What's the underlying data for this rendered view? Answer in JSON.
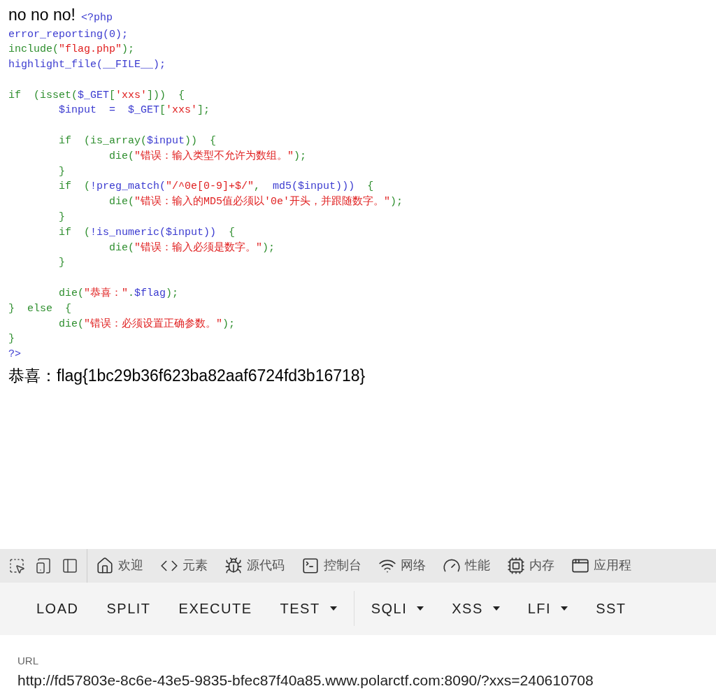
{
  "page": {
    "heading": "no no no!",
    "code": [
      {
        "kind": "code",
        "tokens": [
          {
            "kind": "default",
            "text": "<?php"
          }
        ]
      },
      {
        "kind": "code",
        "tokens": [
          {
            "kind": "default",
            "text": "error_reporting(0);"
          }
        ]
      },
      {
        "kind": "code",
        "tokens": [
          {
            "kind": "keyword",
            "text": "include("
          },
          {
            "kind": "string",
            "text": "\"flag.php\""
          },
          {
            "kind": "keyword",
            "text": ");"
          }
        ]
      },
      {
        "kind": "code",
        "tokens": [
          {
            "kind": "default",
            "text": "highlight_file(__FILE__);"
          }
        ]
      },
      {
        "kind": "blank"
      },
      {
        "kind": "code",
        "tokens": [
          {
            "kind": "keyword",
            "text": "if  (isset("
          },
          {
            "kind": "default",
            "text": "$_GET"
          },
          {
            "kind": "keyword",
            "text": "["
          },
          {
            "kind": "string",
            "text": "'xxs'"
          },
          {
            "kind": "keyword",
            "text": "]))  {"
          }
        ]
      },
      {
        "kind": "code",
        "tokens": [
          {
            "kind": "default",
            "text": "        $input  =  $_GET"
          },
          {
            "kind": "keyword",
            "text": "["
          },
          {
            "kind": "string",
            "text": "'xxs'"
          },
          {
            "kind": "keyword",
            "text": "];"
          }
        ]
      },
      {
        "kind": "blank"
      },
      {
        "kind": "code",
        "tokens": [
          {
            "kind": "keyword",
            "text": "        if  (is_array("
          },
          {
            "kind": "default",
            "text": "$input"
          },
          {
            "kind": "keyword",
            "text": "))  {"
          }
        ]
      },
      {
        "kind": "code",
        "tokens": [
          {
            "kind": "keyword",
            "text": "                die("
          },
          {
            "kind": "string",
            "text": "\"错误：输入类型不允许为数组。\""
          },
          {
            "kind": "keyword",
            "text": ");"
          }
        ]
      },
      {
        "kind": "code",
        "tokens": [
          {
            "kind": "keyword",
            "text": "        }"
          }
        ]
      },
      {
        "kind": "code",
        "tokens": [
          {
            "kind": "keyword",
            "text": "        if  ("
          },
          {
            "kind": "default",
            "text": "!preg_match("
          },
          {
            "kind": "string",
            "text": "\"/^0e[0-9]+$/\""
          },
          {
            "kind": "keyword",
            "text": ",  "
          },
          {
            "kind": "default",
            "text": "md5($input)))"
          },
          {
            "kind": "keyword",
            "text": "  {"
          }
        ]
      },
      {
        "kind": "code",
        "tokens": [
          {
            "kind": "keyword",
            "text": "                die("
          },
          {
            "kind": "string",
            "text": "\"错误：输入的MD5值必须以'0e'开头，并跟随数字。\""
          },
          {
            "kind": "keyword",
            "text": ");"
          }
        ]
      },
      {
        "kind": "code",
        "tokens": [
          {
            "kind": "keyword",
            "text": "        }"
          }
        ]
      },
      {
        "kind": "code",
        "tokens": [
          {
            "kind": "keyword",
            "text": "        if  ("
          },
          {
            "kind": "default",
            "text": "!is_numeric($input))"
          },
          {
            "kind": "keyword",
            "text": "  {"
          }
        ]
      },
      {
        "kind": "code",
        "tokens": [
          {
            "kind": "keyword",
            "text": "                die("
          },
          {
            "kind": "string",
            "text": "\"错误：输入必须是数字。\""
          },
          {
            "kind": "keyword",
            "text": ");"
          }
        ]
      },
      {
        "kind": "code",
        "tokens": [
          {
            "kind": "keyword",
            "text": "        }"
          }
        ]
      },
      {
        "kind": "blank"
      },
      {
        "kind": "code",
        "tokens": [
          {
            "kind": "keyword",
            "text": "        die("
          },
          {
            "kind": "string",
            "text": "\"恭喜：\""
          },
          {
            "kind": "keyword",
            "text": "."
          },
          {
            "kind": "default",
            "text": "$flag"
          },
          {
            "kind": "keyword",
            "text": ");"
          }
        ]
      },
      {
        "kind": "code",
        "tokens": [
          {
            "kind": "keyword",
            "text": "}  else  {"
          }
        ]
      },
      {
        "kind": "code",
        "tokens": [
          {
            "kind": "keyword",
            "text": "        die("
          },
          {
            "kind": "string",
            "text": "\"错误：必须设置正确参数。\""
          },
          {
            "kind": "keyword",
            "text": ");"
          }
        ]
      },
      {
        "kind": "code",
        "tokens": [
          {
            "kind": "keyword",
            "text": "}"
          }
        ]
      },
      {
        "kind": "code",
        "tokens": [
          {
            "kind": "default",
            "text": "?>"
          }
        ]
      }
    ],
    "output": "恭喜：flag{1bc29b36f623ba82aaf6724fd3b16718}"
  },
  "devtools": {
    "tools": [
      {
        "kind": "inspect"
      },
      {
        "kind": "device"
      },
      {
        "kind": "dock"
      }
    ],
    "tabs": [
      {
        "kind": "home",
        "label": "欢迎"
      },
      {
        "kind": "code",
        "label": "元素"
      },
      {
        "kind": "bug",
        "label": "源代码"
      },
      {
        "kind": "console",
        "label": "控制台"
      },
      {
        "kind": "wifi",
        "label": "网络"
      },
      {
        "kind": "gauge",
        "label": "性能"
      },
      {
        "kind": "chip",
        "label": "内存"
      },
      {
        "kind": "app",
        "label": "应用程"
      }
    ]
  },
  "hackbar": {
    "buttons": [
      {
        "kind": "plain",
        "label": "LOAD"
      },
      {
        "kind": "plain",
        "label": "SPLIT"
      },
      {
        "kind": "plain",
        "label": "EXECUTE"
      },
      {
        "kind": "menu",
        "label": "TEST"
      },
      {
        "kind": "divider"
      },
      {
        "kind": "menu",
        "label": "SQLI"
      },
      {
        "kind": "menu",
        "label": "XSS"
      },
      {
        "kind": "menu",
        "label": "LFI"
      },
      {
        "kind": "plain",
        "label": "SST"
      }
    ],
    "url": {
      "label": "URL",
      "value": "http://fd57803e-8c6e-43e5-9835-bfec87f40a85.www.polarctf.com:8090/?xxs=240610708"
    }
  }
}
